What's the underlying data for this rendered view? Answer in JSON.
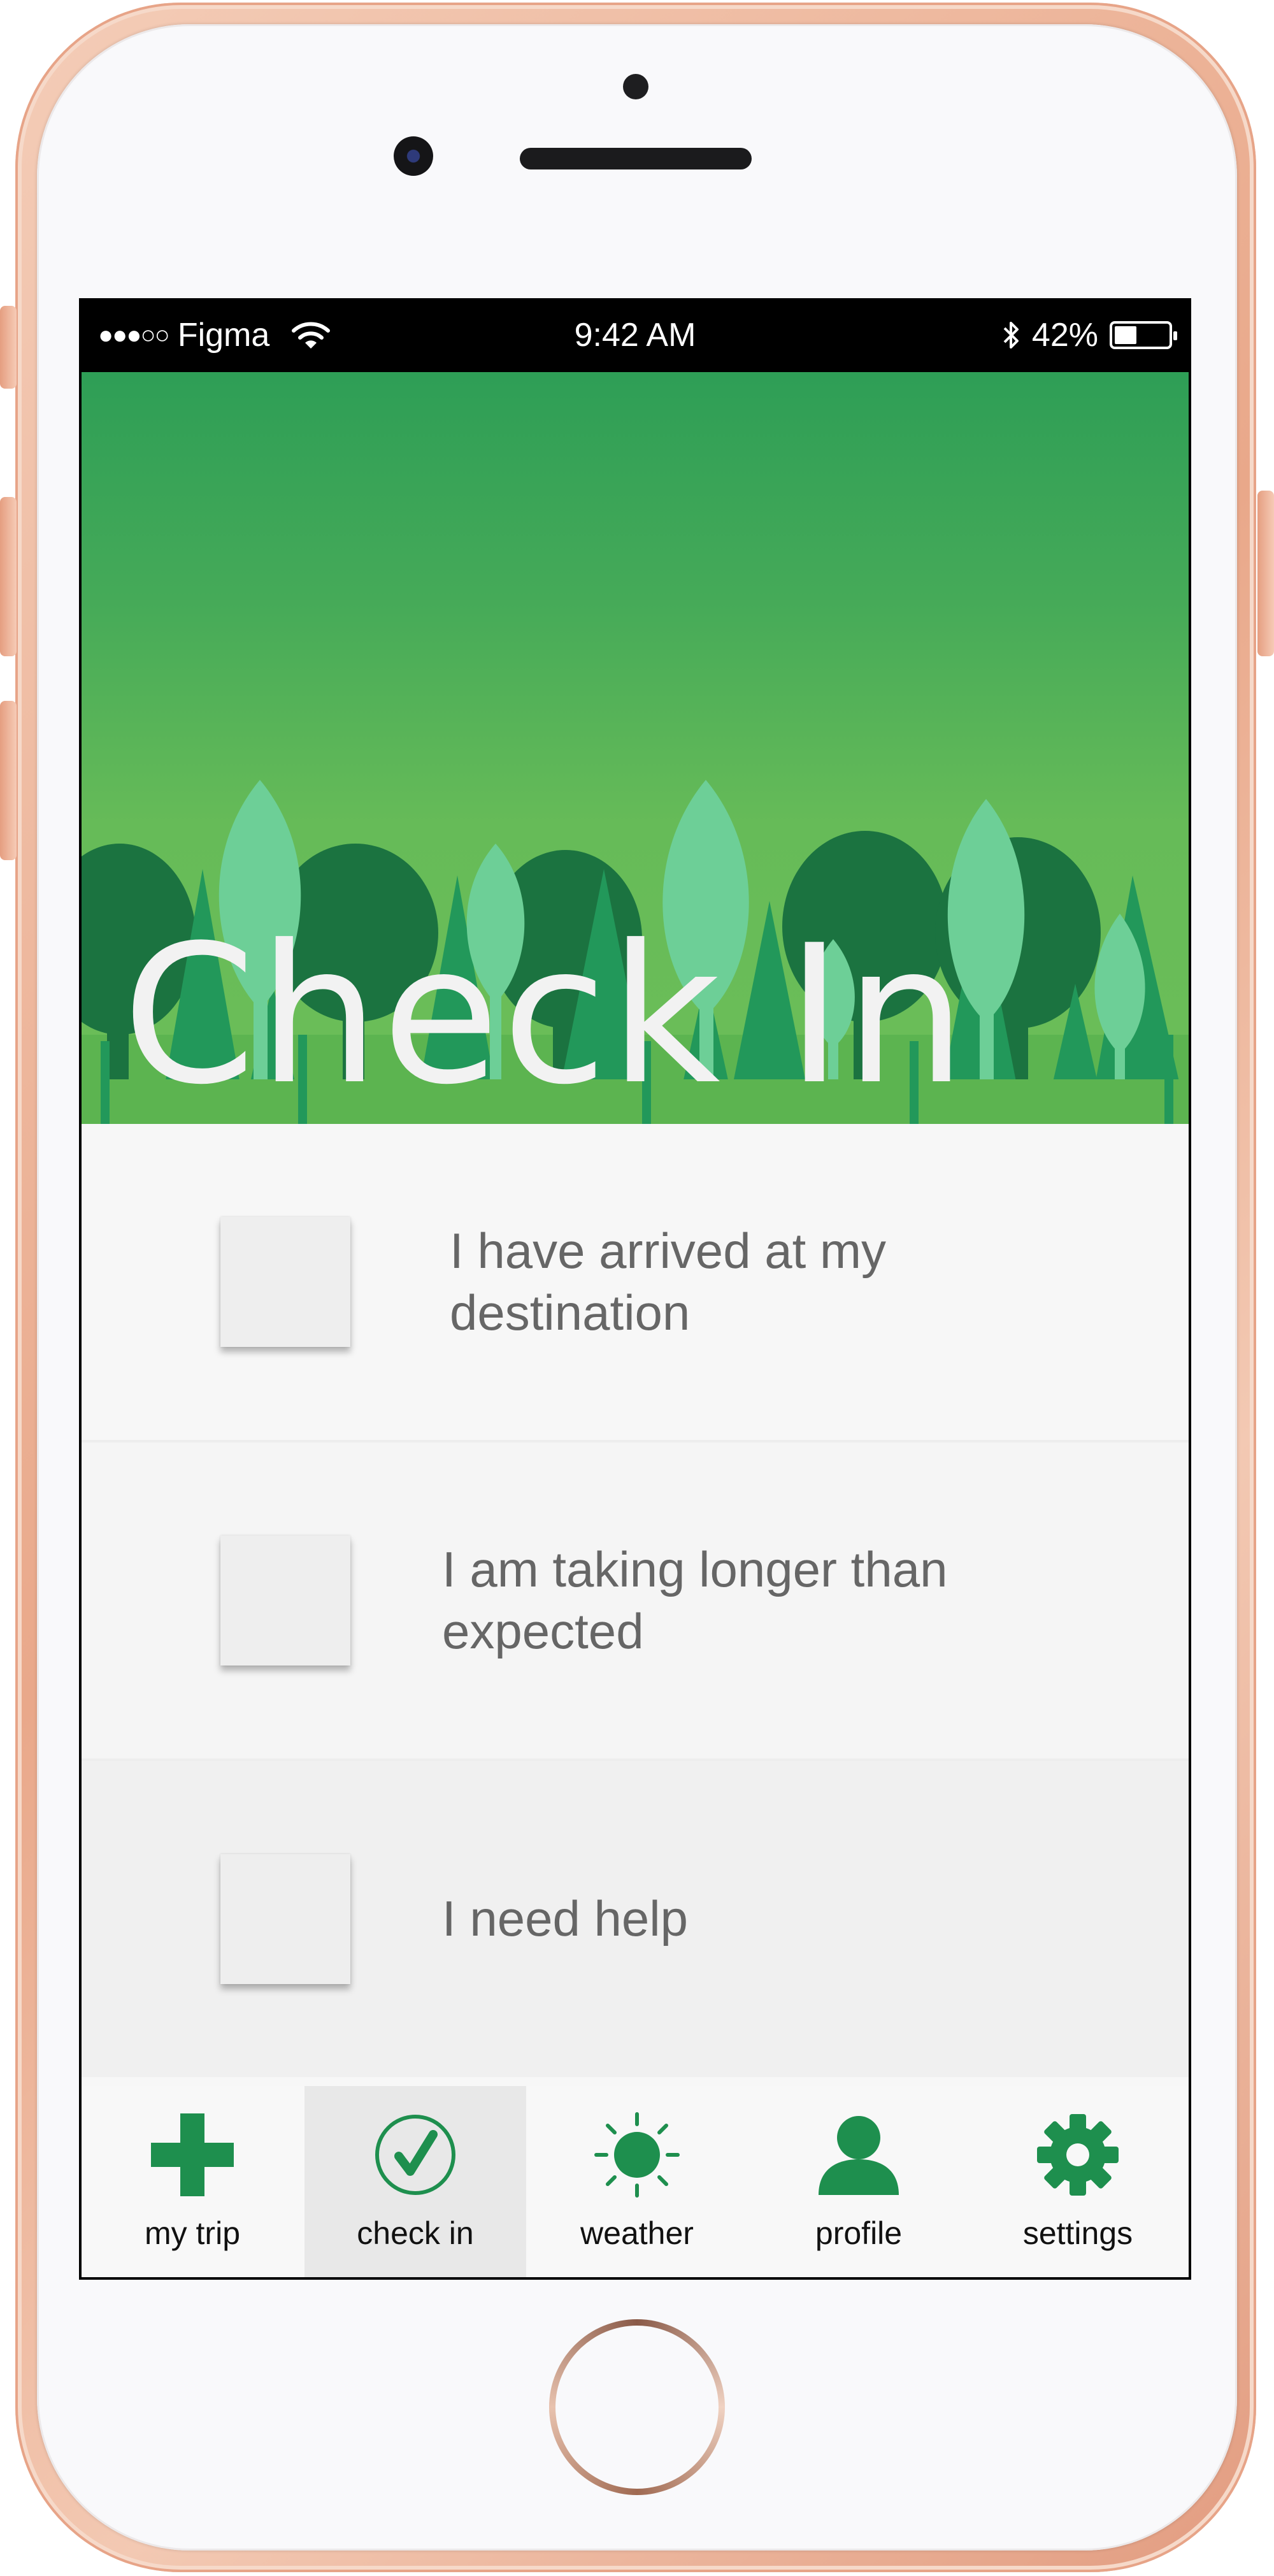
{
  "status_bar": {
    "signal": "●●●○○",
    "carrier": "Figma",
    "time": "9:42 AM",
    "battery_percent": "42%",
    "battery_level": 0.42
  },
  "header": {
    "title": "Check In"
  },
  "options": [
    {
      "label": "I have arrived at my destination",
      "checked": false
    },
    {
      "label": "I am taking longer than expected",
      "checked": false
    },
    {
      "label": "I need help",
      "checked": false
    }
  ],
  "tabs": [
    {
      "label": "my trip",
      "icon": "plus-icon",
      "active": false
    },
    {
      "label": "check in",
      "icon": "check-circle-icon",
      "active": true
    },
    {
      "label": "weather",
      "icon": "sun-icon",
      "active": false
    },
    {
      "label": "profile",
      "icon": "person-icon",
      "active": false
    },
    {
      "label": "settings",
      "icon": "gear-icon",
      "active": false
    }
  ],
  "colors": {
    "accent": "#1e8f4e",
    "header_top": "#2e9e56",
    "header_bottom": "#6cbe58",
    "tree_dark": "#1b7340",
    "tree_mid": "#22985a",
    "tree_light": "#6dcf97"
  }
}
